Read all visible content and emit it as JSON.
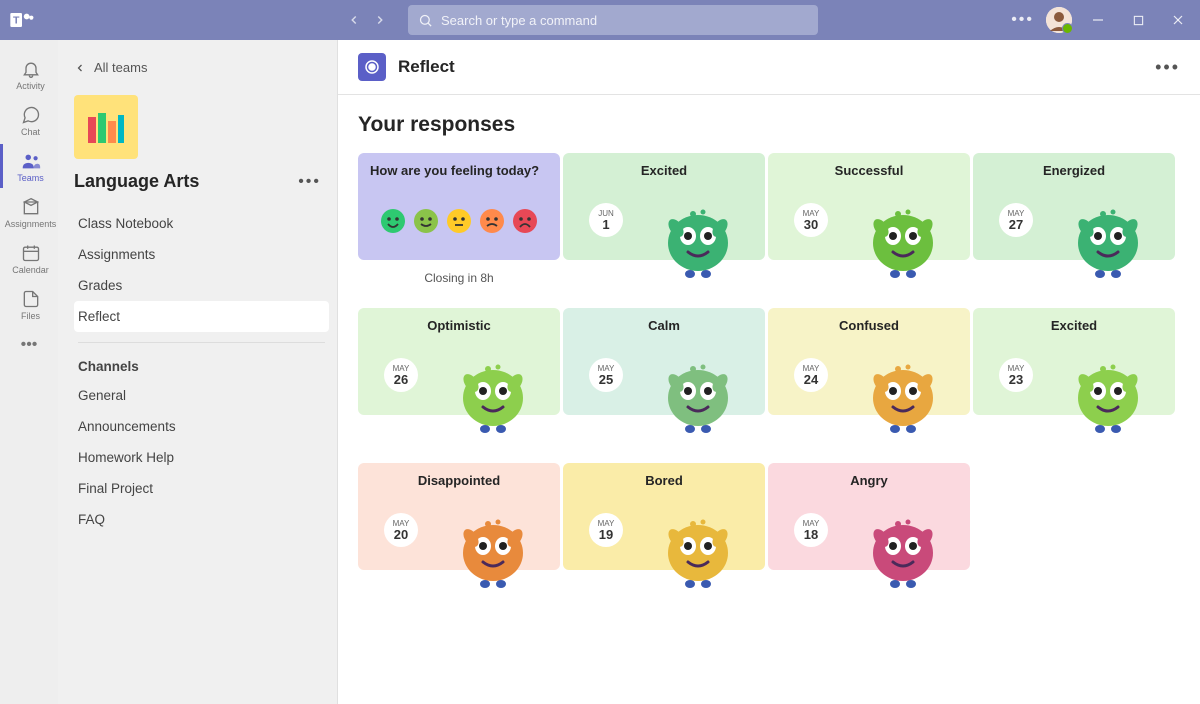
{
  "titlebar": {
    "search_placeholder": "Search or type a command"
  },
  "rail": {
    "items": [
      {
        "label": "Activity",
        "icon": "bell"
      },
      {
        "label": "Chat",
        "icon": "chat"
      },
      {
        "label": "Teams",
        "icon": "teams",
        "active": true
      },
      {
        "label": "Assignments",
        "icon": "assignments"
      },
      {
        "label": "Calendar",
        "icon": "calendar"
      },
      {
        "label": "Files",
        "icon": "files"
      }
    ]
  },
  "sidebar": {
    "back_label": "All teams",
    "team_name": "Language Arts",
    "links": [
      {
        "label": "Class Notebook"
      },
      {
        "label": "Assignments"
      },
      {
        "label": "Grades"
      },
      {
        "label": "Reflect",
        "active": true
      }
    ],
    "channels_heading": "Channels",
    "channels": [
      {
        "label": "General"
      },
      {
        "label": "Announcements"
      },
      {
        "label": "Homework Help"
      },
      {
        "label": "Final Project"
      },
      {
        "label": "FAQ"
      }
    ]
  },
  "content": {
    "app_title": "Reflect",
    "page_title": "Your responses",
    "prompt": {
      "question": "How are you feeling today?",
      "closing": "Closing in 8h",
      "emoji_colors": [
        "#2ec971",
        "#8bc34a",
        "#ffca28",
        "#ff8a4c",
        "#e74856"
      ]
    },
    "cards": [
      [
        {
          "mood": "Excited",
          "month": "JUN",
          "day": "1",
          "bg": "bg-green-soft",
          "color": "#3bb273"
        },
        {
          "mood": "Successful",
          "month": "MAY",
          "day": "30",
          "bg": "bg-green-light",
          "color": "#6cbf3e"
        },
        {
          "mood": "Energized",
          "month": "MAY",
          "day": "27",
          "bg": "bg-green-soft",
          "color": "#3bb273"
        }
      ],
      [
        {
          "mood": "Optimistic",
          "month": "MAY",
          "day": "26",
          "bg": "bg-green-light",
          "color": "#8dcf4d"
        },
        {
          "mood": "Calm",
          "month": "MAY",
          "day": "25",
          "bg": "bg-mint",
          "color": "#7fbf7f"
        },
        {
          "mood": "Confused",
          "month": "MAY",
          "day": "24",
          "bg": "bg-yellow-soft",
          "color": "#e8a740"
        },
        {
          "mood": "Excited",
          "month": "MAY",
          "day": "23",
          "bg": "bg-green-light",
          "color": "#8dcf4d"
        }
      ],
      [
        {
          "mood": "Disappointed",
          "month": "MAY",
          "day": "20",
          "bg": "bg-peach",
          "color": "#e88a3c"
        },
        {
          "mood": "Bored",
          "month": "MAY",
          "day": "19",
          "bg": "bg-yellow",
          "color": "#e8b83c"
        },
        {
          "mood": "Angry",
          "month": "MAY",
          "day": "18",
          "bg": "bg-pink",
          "color": "#c94a7a"
        }
      ]
    ]
  }
}
